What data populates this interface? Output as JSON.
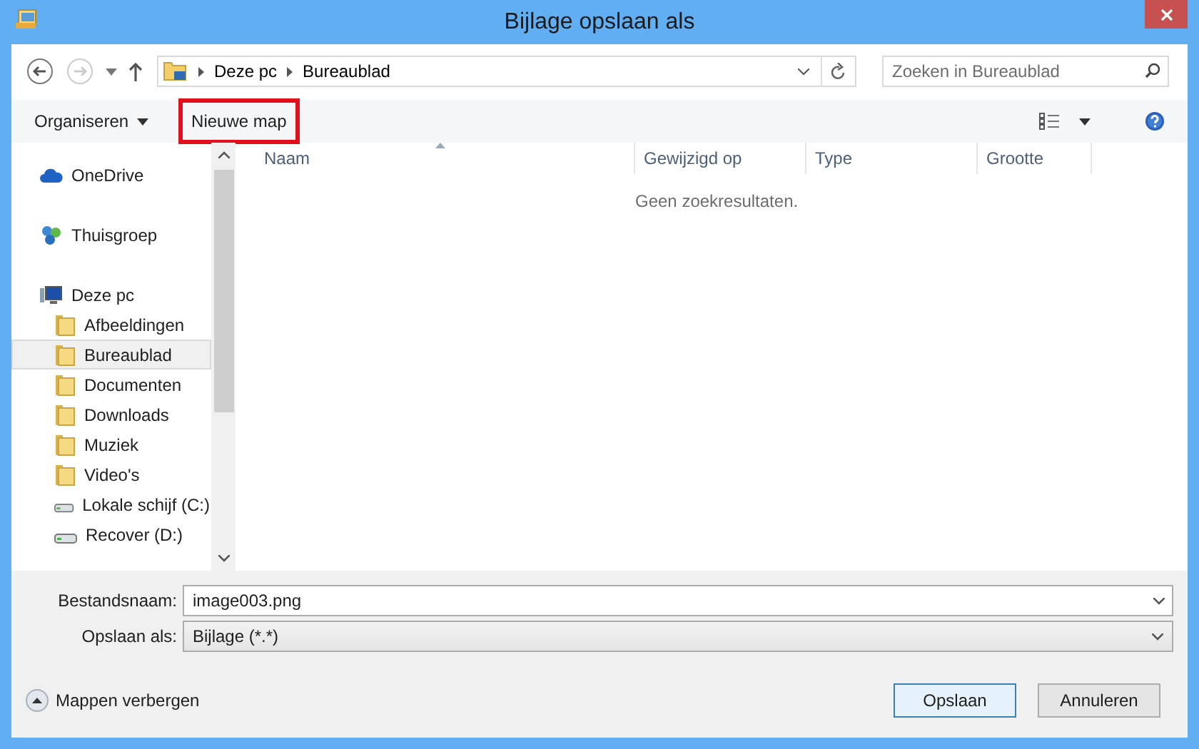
{
  "window": {
    "title": "Bijlage opslaan als"
  },
  "address": {
    "crumbs": [
      "Deze pc",
      "Bureaublad"
    ],
    "search_placeholder": "Zoeken in Bureaublad"
  },
  "toolbar": {
    "items": [
      {
        "label": "Organiseren",
        "kind": "menu",
        "highlighted": false
      },
      {
        "label": "Nieuwe map",
        "kind": "button",
        "highlighted": true
      }
    ]
  },
  "sidebar": {
    "items": [
      {
        "label": "OneDrive",
        "kind": "cloud",
        "selected": false
      },
      {
        "label": "Thuisgroep",
        "kind": "homegroup",
        "selected": false
      },
      {
        "label": "Deze pc",
        "kind": "pc",
        "selected": false,
        "children": [
          {
            "label": "Afbeeldingen",
            "kind": "folder",
            "selected": false
          },
          {
            "label": "Bureaublad",
            "kind": "folder",
            "selected": true
          },
          {
            "label": "Documenten",
            "kind": "folder",
            "selected": false
          },
          {
            "label": "Downloads",
            "kind": "folder",
            "selected": false
          },
          {
            "label": "Muziek",
            "kind": "folder",
            "selected": false
          },
          {
            "label": "Video's",
            "kind": "folder",
            "selected": false
          },
          {
            "label": "Lokale schijf (C:)",
            "kind": "drive",
            "selected": false
          },
          {
            "label": "Recover (D:)",
            "kind": "drive",
            "selected": false
          }
        ]
      }
    ]
  },
  "file_list": {
    "columns": [
      "Naam",
      "Gewijzigd op",
      "Type",
      "Grootte"
    ],
    "empty_message": "Geen zoekresultaten."
  },
  "form": {
    "filename_label": "Bestandsnaam:",
    "filename": "image003.png",
    "type_label": "Opslaan als:",
    "type": "Bijlage (*.*)"
  },
  "footer": {
    "toggle": "Mappen verbergen",
    "buttons": [
      {
        "label": "Opslaan",
        "default": true
      },
      {
        "label": "Annuleren",
        "default": false
      }
    ]
  }
}
